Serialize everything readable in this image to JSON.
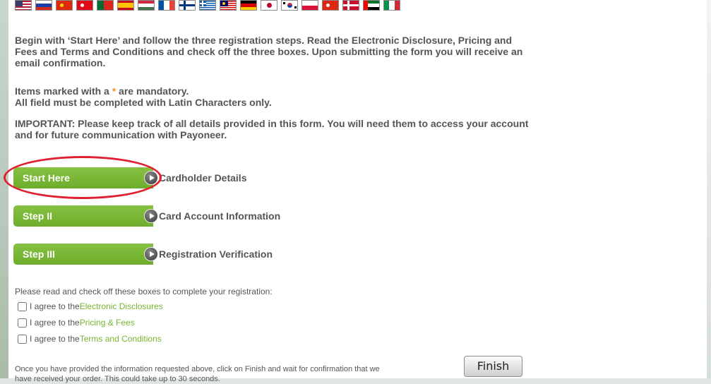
{
  "language_flags": [
    {
      "name": "flag-us-icon",
      "type": "us"
    },
    {
      "name": "flag-russia-icon",
      "type": "h3",
      "c": [
        "#ffffff",
        "#1c3fa8",
        "#d52b1e"
      ]
    },
    {
      "name": "flag-china-icon",
      "type": "solid",
      "c": [
        "#de2910",
        "#ffde00"
      ]
    },
    {
      "name": "flag-turkey-icon",
      "type": "solid",
      "c": [
        "#e30a17",
        "#ffffff"
      ]
    },
    {
      "name": "flag-portugal-icon",
      "type": "v2",
      "c": [
        "#046a38",
        "#da291c"
      ]
    },
    {
      "name": "flag-spain-icon",
      "type": "es",
      "c": [
        "#c60b1e",
        "#ffc400"
      ]
    },
    {
      "name": "flag-hungary-icon",
      "type": "h3",
      "c": [
        "#cd2a3e",
        "#ffffff",
        "#436f4d"
      ]
    },
    {
      "name": "flag-france-icon",
      "type": "v3",
      "c": [
        "#0055a4",
        "#ffffff",
        "#ef4135"
      ]
    },
    {
      "name": "flag-finland-icon",
      "type": "nordic",
      "c": [
        "#ffffff",
        "#003580"
      ]
    },
    {
      "name": "flag-greece-icon",
      "type": "gr",
      "c": [
        "#0d5eaf",
        "#ffffff"
      ]
    },
    {
      "name": "flag-malaysia-icon",
      "type": "my",
      "c": [
        "#cc0001",
        "#ffffff",
        "#010066"
      ]
    },
    {
      "name": "flag-germany-icon",
      "type": "h3",
      "c": [
        "#000000",
        "#dd0000",
        "#ffce00"
      ]
    },
    {
      "name": "flag-japan-icon",
      "type": "dot",
      "c": [
        "#ffffff",
        "#bc002d"
      ]
    },
    {
      "name": "flag-korea-icon",
      "type": "kr",
      "c": [
        "#ffffff",
        "#cd2e3a",
        "#0047a0"
      ]
    },
    {
      "name": "flag-poland-icon",
      "type": "h2",
      "c": [
        "#ffffff",
        "#dc143c"
      ]
    },
    {
      "name": "flag-hongkong-icon",
      "type": "solid",
      "c": [
        "#de2910",
        "#ffffff"
      ]
    },
    {
      "name": "flag-denmark-icon",
      "type": "nordic",
      "c": [
        "#c8102e",
        "#ffffff"
      ]
    },
    {
      "name": "flag-uae-icon",
      "type": "ae",
      "c": [
        "#00732f",
        "#ffffff",
        "#000000",
        "#ff0000"
      ]
    },
    {
      "name": "flag-italy-icon",
      "type": "v3",
      "c": [
        "#009246",
        "#ffffff",
        "#ce2b37"
      ]
    }
  ],
  "intro": "Begin with ‘Start Here’ and follow the three registration steps. Read the Electronic Disclosure, Pricing and Fees and Terms and Conditions and check off the three boxes. Upon submitting the form you will receive an email confirmation.",
  "mandatory": {
    "before_star": "Items marked with a ",
    "star": "*",
    "after_star": " are mandatory.",
    "latin_note": "All field must be completed with Latin Characters only."
  },
  "important": "IMPORTANT: Please keep track of all details provided in this form. You will need them to access your account and for future communication with Payoneer.",
  "steps": [
    {
      "label": "Start Here",
      "description": "Cardholder Details"
    },
    {
      "label": "Step II",
      "description": "Card Account Information"
    },
    {
      "label": "Step III",
      "description": "Registration Verification"
    }
  ],
  "agreements": {
    "instruction": "Please read and check off these boxes to complete your registration:",
    "prefix": "I agree to the ",
    "items": [
      {
        "link": "Electronic Disclosures",
        "checked": false
      },
      {
        "link": "Pricing & Fees",
        "checked": false
      },
      {
        "link": "Terms and Conditions",
        "checked": false
      }
    ]
  },
  "finish_note": "Once you have provided the information requested above, click on Finish and wait for confirmation that we have received your order. This could take up to 30 seconds.",
  "finish_label": "Finish",
  "colors": {
    "accent_green": "#76b530",
    "step_green": "#6ead2c",
    "highlight_red": "#e02030",
    "star_orange": "#f29c1f"
  }
}
